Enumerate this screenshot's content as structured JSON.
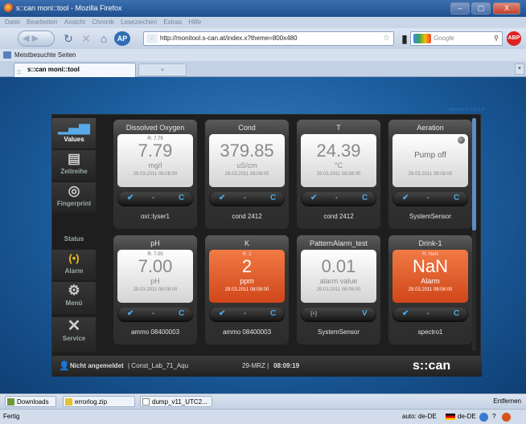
{
  "window": {
    "title": "s::can moni::tool - Mozilla Firefox",
    "min": "–",
    "max": "▢",
    "close": "X"
  },
  "menu": [
    "Datei",
    "Bearbeiten",
    "Ansicht",
    "Chronik",
    "Lesezeichen",
    "Extras",
    "Hilfe"
  ],
  "nav": {
    "url": "http://monitool.s-can.at/index.x?theme=800x480",
    "search_placeholder": "Google"
  },
  "bookmarks": {
    "label": "Meistbesuchte Seiten"
  },
  "tab": {
    "label": "s::can moni::tool",
    "new": "+"
  },
  "app": {
    "version": "Version 1.0.0.3.0",
    "sidebar": [
      {
        "label": "Values",
        "icon": "bar-chart-icon"
      },
      {
        "label": "Zeitreihe",
        "icon": "timeseries-icon"
      },
      {
        "label": "Fingerprint",
        "icon": "fingerprint-icon"
      },
      {
        "label": "Status",
        "icon": ""
      },
      {
        "label": "Alarm",
        "icon": "alarm-icon"
      },
      {
        "label": "Menü",
        "icon": "gear-icon"
      },
      {
        "label": "Service",
        "icon": "tools-icon"
      }
    ],
    "tiles": [
      {
        "title": "Dissolved Oxygen",
        "r": "R: 7.79",
        "value": "7.79",
        "unit": "mg/l",
        "ts": "29.03.2011 08:08:00",
        "style": "normal",
        "status": [
          "✔",
          "•",
          "C"
        ],
        "sensor": "oxi::lyser1"
      },
      {
        "title": "Cond",
        "r": "",
        "value": "379.85",
        "unit": "uS/cm",
        "ts": "29.03.2011 08:08:00",
        "style": "normal",
        "status": [
          "✔",
          "•",
          "C"
        ],
        "sensor": "cond 2412"
      },
      {
        "title": "T",
        "r": "",
        "value": "24.39",
        "unit": "°C",
        "ts": "29.03.2011 08:08:00",
        "style": "normal",
        "status": [
          "✔",
          "•",
          "C"
        ],
        "sensor": "cond 2412"
      },
      {
        "title": "Aeration",
        "r": "",
        "value": "Pump off",
        "unit": "",
        "ts": "29.03.2011 08:08:00",
        "style": "pump",
        "status": [
          "✔",
          "•",
          "C"
        ],
        "sensor": "SystemSensor"
      },
      {
        "title": "pH",
        "r": "R: 7.00",
        "value": "7.00",
        "unit": "pH",
        "ts": "29.03.2011 08:08:00",
        "style": "normal",
        "status": [
          "✔",
          "•",
          "C"
        ],
        "sensor": "ammo 08400003"
      },
      {
        "title": "K",
        "r": "R: 2",
        "value": "2",
        "unit": "ppm",
        "ts": "29.03.2011 08:08:00",
        "style": "alarm",
        "status": [
          "✔",
          "•",
          "C"
        ],
        "sensor": "ammo 08400003"
      },
      {
        "title": "PatternAlarm_test",
        "r": "",
        "value": "0.01",
        "unit": "alarm value",
        "ts": "29.03.2011 08:08:00",
        "style": "normal",
        "status": [
          "(•)",
          "",
          "V"
        ],
        "sensor": "SystemSensor"
      },
      {
        "title": "Drink-1",
        "r": "R: NaN",
        "value": "NaN",
        "unit": "Alarm",
        "ts": "29.03.2011 08:08:00",
        "style": "alarm",
        "status": [
          "✔",
          "•",
          "C"
        ],
        "sensor": "spectro1"
      }
    ],
    "footer": {
      "user": "Nicht angemeldet",
      "station": "| Const_Lab_71_Aqu",
      "date": "29-MRZ | ",
      "time": "08:09:19",
      "logo": "s::can"
    }
  },
  "downloads": {
    "items": [
      "Downloads",
      "errorlog.zip",
      "dump_v11_UTC2..."
    ],
    "remove": "Entfernen"
  },
  "status": {
    "text": "Fertig",
    "lang1": "auto: de-DE",
    "lang2": "de-DE",
    "help": "?"
  }
}
